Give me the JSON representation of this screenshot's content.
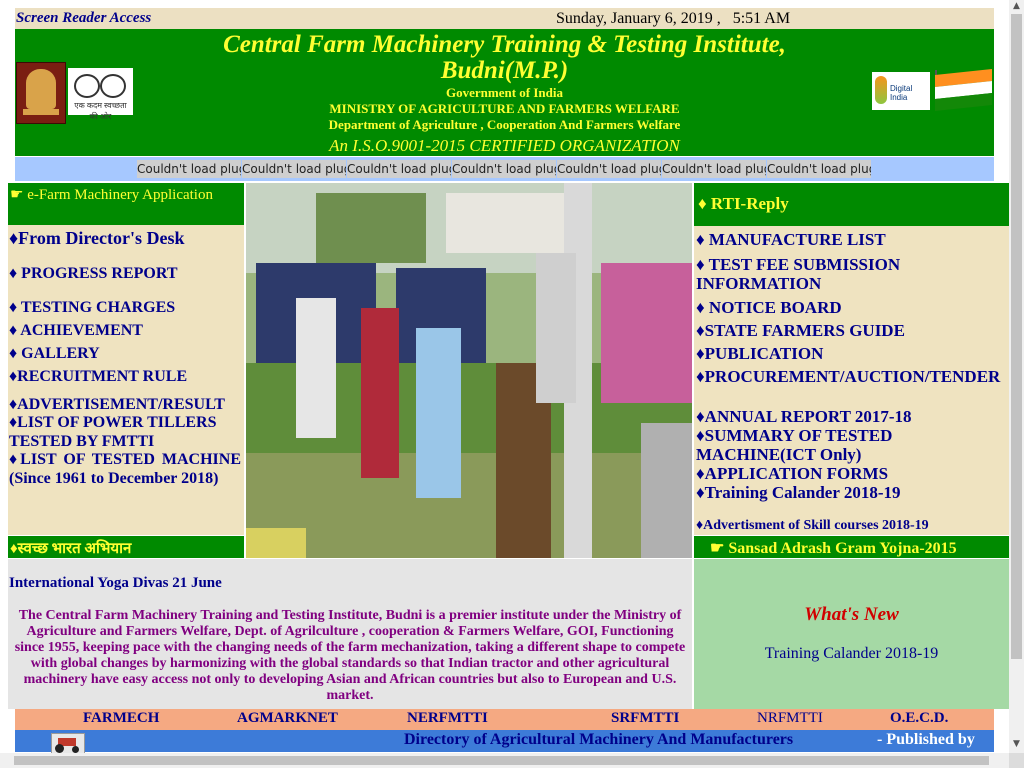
{
  "top_bar": {
    "screen_reader": "Screen Reader Access",
    "date": "Sunday, January 6, 2019 ,",
    "time": "5:51 AM"
  },
  "header": {
    "title_line1": "Central Farm Machinery Training & Testing Institute,",
    "title_line2": "Budni(M.P.)",
    "government": "Government of India",
    "ministry": "MINISTRY OF AGRICULTURE AND FARMERS WELFARE",
    "department": "Department of Agriculture , Cooperation And  Farmers Welfare",
    "certification": "An I.S.O.9001-2015 CERTIFIED ORGANIZATION",
    "swachh_text": "एक कदम स्वच्छता की ओर",
    "digital_india_text": "Digital India",
    "colors": {
      "header_green": "#008a00",
      "title_yellow": "#ffff33"
    }
  },
  "plugin_bar": {
    "items": [
      "Couldn't load plug-",
      "Couldn't load plug-",
      "Couldn't load plug-",
      "Couldn't load plug-",
      "Couldn't load plug-",
      "Couldn't load plug-",
      "Couldn't load plug-"
    ]
  },
  "left_panel": {
    "efarm": "☛ e-Farm Machinery Application",
    "links": [
      "♦From Director's Desk",
      "♦ PROGRESS REPORT",
      "♦ TESTING CHARGES",
      "♦ ACHIEVEMENT",
      "♦ GALLERY",
      "♦RECRUITMENT RULE",
      "♦ADVERTISEMENT/RESULT",
      "♦LIST OF POWER TILLERS TESTED BY FMTTI",
      "♦LIST OF TESTED MACHINE (Since 1961 to December 2018)"
    ],
    "swach_bharat": "♦स्वच्छ भारत अभियान"
  },
  "right_panel": {
    "rti": "♦ RTI-Reply",
    "links": [
      "♦ MANUFACTURE LIST",
      "♦ TEST FEE SUBMISSION INFORMATION",
      "♦ NOTICE BOARD",
      "♦STATE FARMERS GUIDE",
      "♦PUBLICATION",
      "♦PROCUREMENT/AUCTION/TENDER",
      "♦ANNUAL REPORT 2017-18",
      "♦SUMMARY OF TESTED MACHINE(ICT Only)",
      "♦APPLICATION FORMS",
      "♦Training Calander 2018-19",
      "♦Advertisment of Skill courses 2018-19"
    ],
    "sansad": "☛ Sansad Adrash Gram Yojna-2015"
  },
  "intro": {
    "yoga": "International Yoga Divas 21 June",
    "about": "The Central Farm Machinery Training and Testing Institute, Budni is a premier institute under the Ministry of Agriculture and Farmers Welfare, Dept. of Agrilculture , cooperation & Farmers Welfare,   GOI, Functioning since 1955, keeping pace with the changing needs of the farm mechanization, taking a different shape to compete with global changes by harmonizing with the global standards so that Indian tractor and other agricultural machinery have easy access not only to developing Asian and African countries but also to European and U.S. market."
  },
  "whats_new": {
    "title": "What's New",
    "item": "Training Calander 2018-19"
  },
  "footer": {
    "links": [
      "FARMECH",
      "AGMARKNET",
      "NERFMTTI",
      "SRFMTTI",
      "NRFMTTI",
      "O.E.C.D."
    ],
    "directory": "Directory of Agricultural Machinery And Manufacturers",
    "published": "- Published by"
  }
}
